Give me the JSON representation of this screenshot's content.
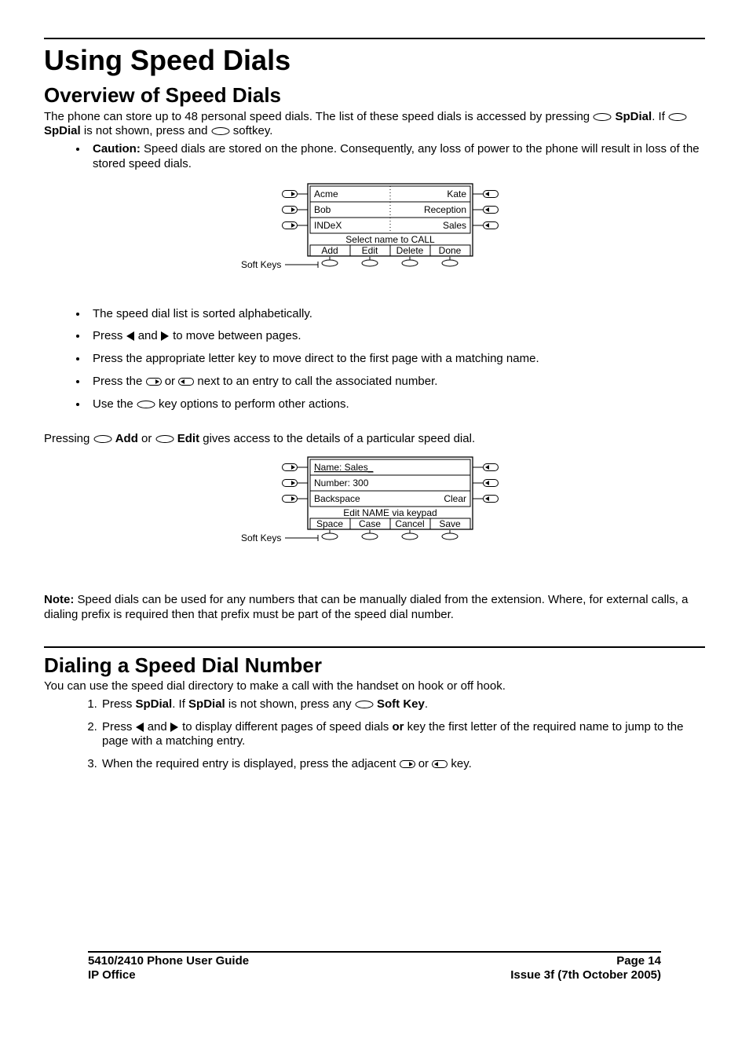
{
  "title": "Using Speed Dials",
  "section1": {
    "heading": "Overview of Speed Dials",
    "intro1": "The phone can store up to 48 personal speed dials. The list of these speed dials is accessed by pressing ",
    "intro_spdial": "SpDial",
    "intro2": ". If ",
    "intro3": " is not shown, press and ",
    "intro4": " softkey.",
    "caution_label": "Caution:",
    "caution_text": "  Speed dials are stored on the phone. Consequently, any loss of power to the phone will result in loss of the stored speed dials.",
    "bullet1": "The speed dial list is sorted alphabetically.",
    "bullet2a": "Press ",
    "bullet2b": " and ",
    "bullet2c": " to move between pages.",
    "bullet3": "Press the appropriate letter key to move direct to the first page with a matching name.",
    "bullet4a": "Press the ",
    "bullet4b": " or ",
    "bullet4c": " next to an entry to call the associated number.",
    "bullet5a": "Use the ",
    "bullet5b": " key options to perform other actions.",
    "pressing1": "Pressing ",
    "pressing_add": "Add",
    "pressing_or": " or ",
    "pressing_edit": "Edit",
    "pressing2": " gives access to the details of a particular speed dial.",
    "note_label": "Note:",
    "note_text": "  Speed dials can be used for any numbers that can be manually dialed from the extension. Where, for external calls, a dialing prefix is required then that prefix must be part of the speed dial number."
  },
  "section2": {
    "heading": "Dialing a Speed Dial Number",
    "intro": "You can use the speed dial directory to make a call with the handset on hook or off hook.",
    "step1a": "Press ",
    "step1_spdial": "SpDial",
    "step1b": ". If ",
    "step1c": " is not shown, press any ",
    "step1_softkey": "Soft Key",
    "step1d": ".",
    "step2a": "Press ",
    "step2b": " and ",
    "step2c": " to display different pages of speed dials ",
    "step2_or": "or",
    "step2d": " key the first letter of the required name to jump to the page with a matching entry.",
    "step3a": "When the required entry is displayed, press the adjacent ",
    "step3b": " or ",
    "step3c": " key."
  },
  "fig1": {
    "rows": [
      [
        "Acme",
        "Kate"
      ],
      [
        "Bob",
        "Reception"
      ],
      [
        "INDeX",
        "Sales"
      ]
    ],
    "banner": "Select name to CALL",
    "softkeys": [
      "Add",
      "Edit",
      "Delete",
      "Done"
    ],
    "label": "Soft Keys"
  },
  "fig2": {
    "rows": [
      [
        "Name: Sales_",
        ""
      ],
      [
        "Number: 300",
        ""
      ],
      [
        "Backspace",
        "Clear"
      ]
    ],
    "banner": "Edit NAME via keypad",
    "softkeys": [
      "Space",
      "Case",
      "Cancel",
      "Save"
    ],
    "label": "Soft Keys"
  },
  "footer": {
    "left1": "5410/2410 Phone User Guide",
    "right1": "Page 14",
    "left2": "IP Office",
    "right2": "Issue 3f (7th October 2005)"
  }
}
